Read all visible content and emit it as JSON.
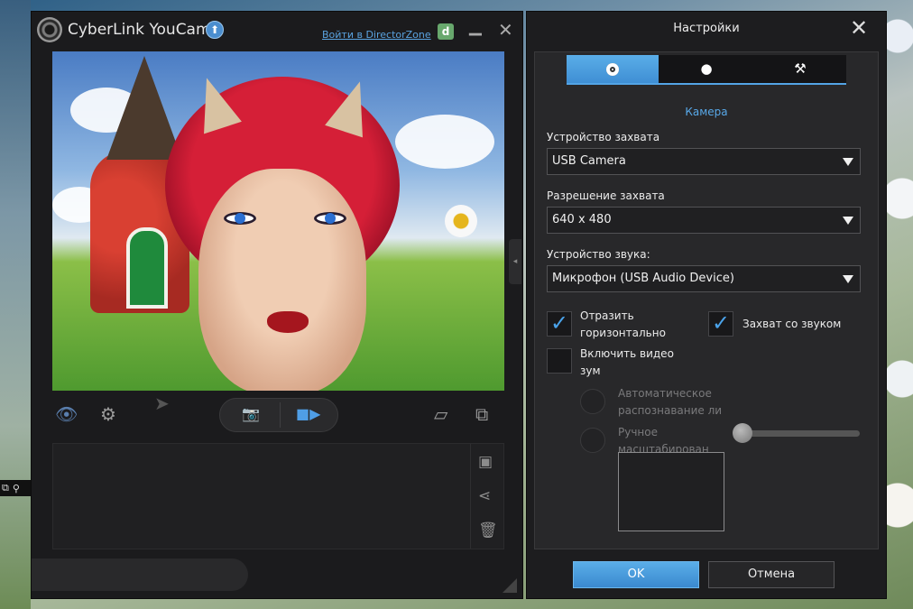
{
  "youcam": {
    "title": "CyberLink YouCam",
    "login_link": "Войти в DirectorZone",
    "directorzone_icon": "d"
  },
  "settings": {
    "title": "Настройки",
    "tabs": [
      {
        "icon": "camera-icon"
      },
      {
        "icon": "record-icon"
      },
      {
        "icon": "tools-icon"
      }
    ],
    "active_tab": 0,
    "section_title": "Камера",
    "capture_device": {
      "label": "Устройство захвата",
      "value": "USB Camera"
    },
    "capture_resolution": {
      "label": "Разрешение захвата",
      "value": "640 x 480"
    },
    "audio_device": {
      "label": "Устройство звука:",
      "value": "Микрофон (USB Audio Device)"
    },
    "mirror": {
      "label_line1": "Отразить",
      "label_line2": "горизонтально",
      "checked": true
    },
    "capture_audio": {
      "label": "Захват со звуком",
      "checked": true
    },
    "video_zoom": {
      "label_line1": "Включить видео",
      "label_line2": "зум",
      "checked": false
    },
    "auto_face": {
      "label_line1": "Автоматическое",
      "label_line2": "распознавание ли"
    },
    "manual_zoom": {
      "label_line1": "Ручное",
      "label_line2": "масштабирован"
    },
    "zoom_level": 0,
    "ok_label": "OK",
    "cancel_label": "Отмена"
  },
  "colors": {
    "accent": "#4a9fe4",
    "window_bg": "#1d1d1f"
  }
}
